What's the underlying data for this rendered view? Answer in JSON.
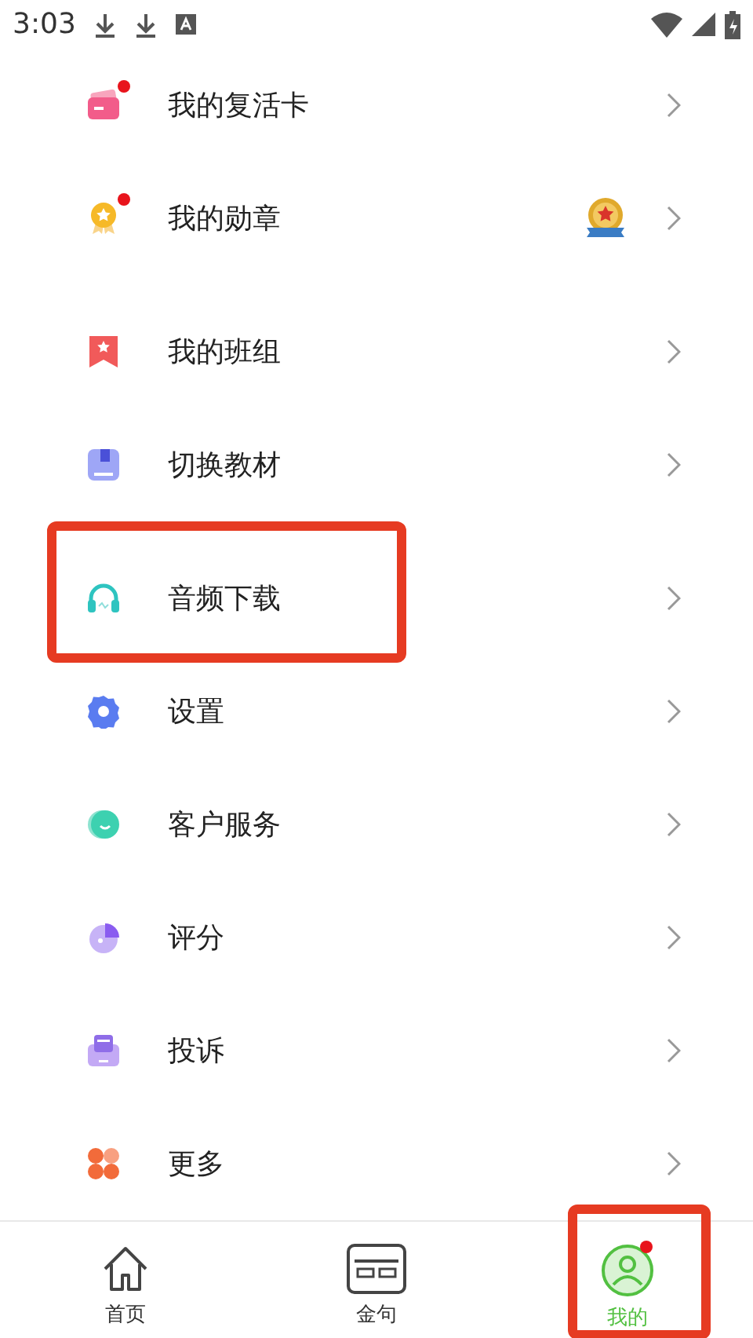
{
  "status_bar": {
    "time": "3:03"
  },
  "sections": [
    {
      "items": [
        {
          "label": "我的复活卡",
          "badge": true,
          "medal": false,
          "highlighted": false
        },
        {
          "label": "我的勋章",
          "badge": true,
          "medal": true,
          "highlighted": false
        }
      ]
    },
    {
      "items": [
        {
          "label": "我的班组",
          "badge": false,
          "medal": false,
          "highlighted": false
        },
        {
          "label": "切换教材",
          "badge": false,
          "medal": false,
          "highlighted": false
        }
      ]
    },
    {
      "items": [
        {
          "label": "音频下载",
          "badge": false,
          "medal": false,
          "highlighted": true
        },
        {
          "label": "设置",
          "badge": false,
          "medal": false,
          "highlighted": false
        },
        {
          "label": "客户服务",
          "badge": false,
          "medal": false,
          "highlighted": false
        },
        {
          "label": "评分",
          "badge": false,
          "medal": false,
          "highlighted": false
        },
        {
          "label": "投诉",
          "badge": false,
          "medal": false,
          "highlighted": false
        },
        {
          "label": "更多",
          "badge": false,
          "medal": false,
          "highlighted": false
        }
      ]
    }
  ],
  "bottom_nav": [
    {
      "label": "首页",
      "selected": false,
      "badge": false,
      "highlighted": false
    },
    {
      "label": "金句",
      "selected": false,
      "badge": false,
      "highlighted": false
    },
    {
      "label": "我的",
      "selected": true,
      "badge": true,
      "highlighted": true
    }
  ]
}
